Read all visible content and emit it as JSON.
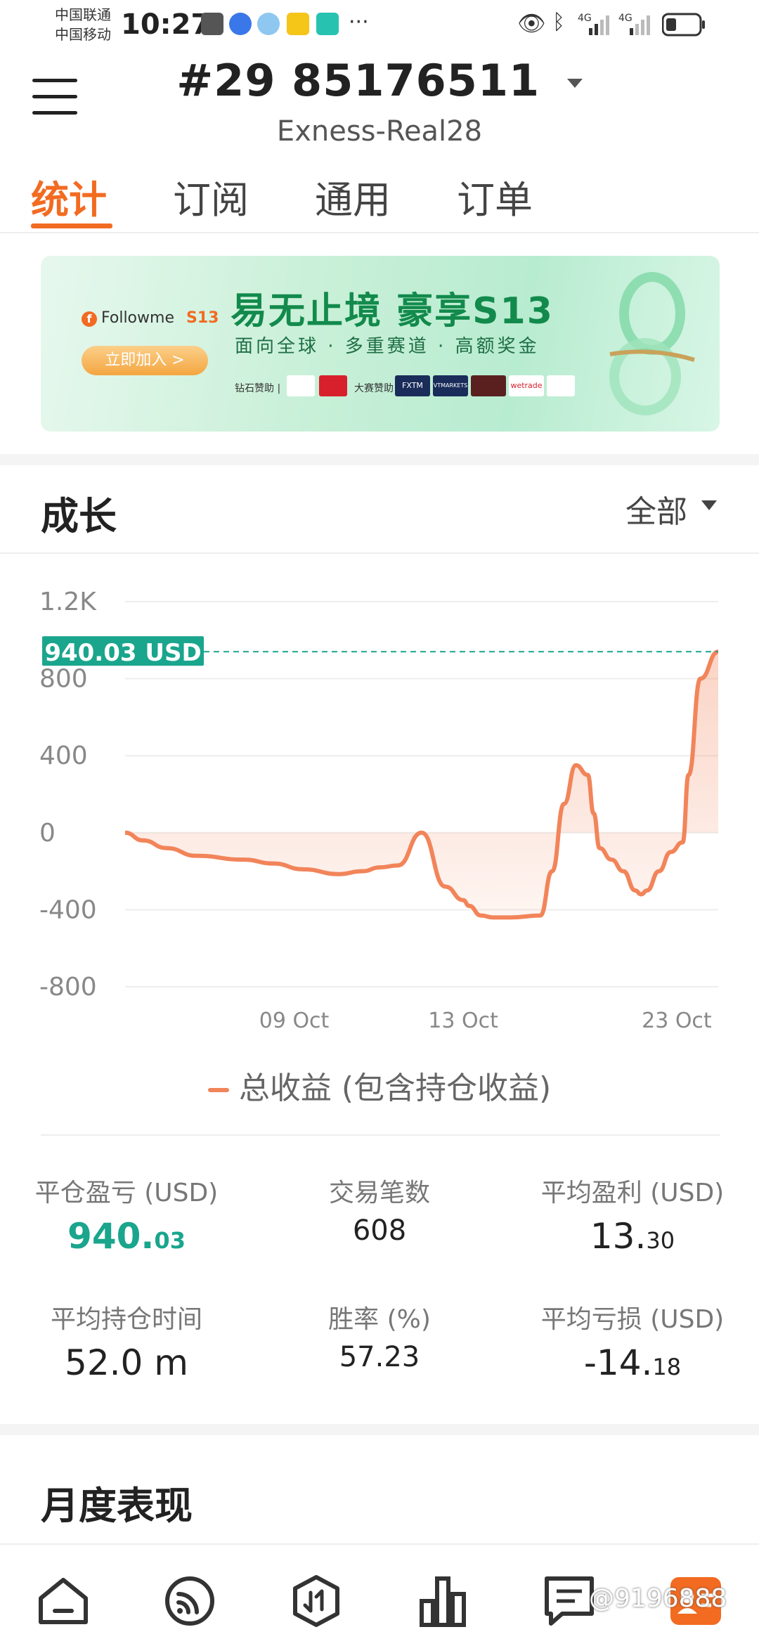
{
  "status_bar": {
    "carrier_1": "中国联通",
    "carrier_2": "中国移动",
    "time": "10:27",
    "network_1": "4G",
    "network_2": "4G"
  },
  "header": {
    "account_title": "#29  85176511",
    "server": "Exness-Real28"
  },
  "tabs": [
    {
      "label": "统计",
      "active": true
    },
    {
      "label": "订阅"
    },
    {
      "label": "通用"
    },
    {
      "label": "订单"
    }
  ],
  "banner": {
    "brand": "Followme",
    "badge": "S13",
    "headline": "易无止境  豪享S13",
    "subtitle": "面向全球 · 多重赛道 · 高额奖金",
    "join_button": "立即加入 >",
    "sponsor_diamond_label": "钻石赞助",
    "sponsor_event_label": "大赛赞助",
    "sponsors": [
      "FXTM",
      "VTMARKETS",
      "wetrade"
    ]
  },
  "growth": {
    "title": "成长",
    "range_select": "全部",
    "current_value_tag": "940.03 USD",
    "legend": "总收益 (包含持仓收益)"
  },
  "chart_data": {
    "type": "area",
    "title": "",
    "xlabel": "",
    "ylabel": "",
    "ylim": [
      -800,
      1200
    ],
    "yticks": [
      "1.2K",
      "800",
      "400",
      "0",
      "-400",
      "-800"
    ],
    "xticks": [
      "09 Oct",
      "13 Oct",
      "23 Oct"
    ],
    "reference_line": {
      "value": 940.03,
      "label": "940.03 USD"
    },
    "series": [
      {
        "name": "总收益 (包含持仓收益)",
        "color": "#f2845a",
        "x": [
          0.0,
          0.03,
          0.07,
          0.12,
          0.2,
          0.25,
          0.3,
          0.36,
          0.4,
          0.43,
          0.46,
          0.5,
          0.54,
          0.57,
          0.58,
          0.6,
          0.62,
          0.65,
          0.7,
          0.72,
          0.74,
          0.76,
          0.78,
          0.79,
          0.8,
          0.82,
          0.84,
          0.86,
          0.87,
          0.88,
          0.9,
          0.92,
          0.94,
          0.95,
          0.97,
          1.0
        ],
        "values": [
          0,
          -40,
          -80,
          -120,
          -140,
          -160,
          -190,
          -215,
          -200,
          -180,
          -170,
          0,
          -280,
          -350,
          -380,
          -430,
          -440,
          -440,
          -430,
          -200,
          150,
          350,
          300,
          100,
          -80,
          -140,
          -200,
          -300,
          -320,
          -300,
          -200,
          -100,
          -50,
          300,
          800,
          940
        ]
      }
    ]
  },
  "stats": [
    {
      "label": "平仓盈亏 (USD)",
      "value_int": "940.",
      "value_dec": "03"
    },
    {
      "label": "交易笔数",
      "value_int": "608",
      "value_dec": ""
    },
    {
      "label": "平均盈利 (USD)",
      "value_int": "13.",
      "value_dec": "30"
    },
    {
      "label": "平均持仓时间",
      "value_int": "52.0 m",
      "value_dec": ""
    },
    {
      "label": "胜率 (%)",
      "value_int": "57.23",
      "value_dec": ""
    },
    {
      "label": "平均亏损 (USD)",
      "value_int": "-14.",
      "value_dec": "18"
    }
  ],
  "monthly": {
    "title": "月度表现"
  },
  "watermark": "@9196888",
  "colors": {
    "accent": "#f26b21",
    "profit": "#1aa58d",
    "line": "#f2845a"
  }
}
